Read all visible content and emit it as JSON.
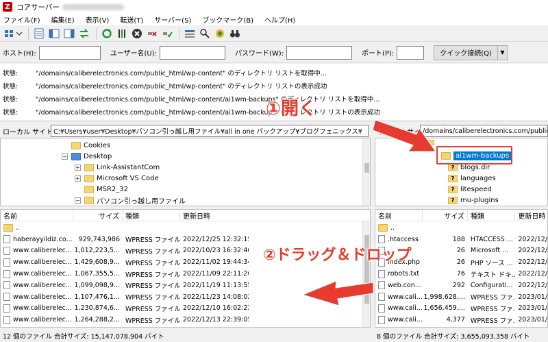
{
  "window": {
    "title": "コアサーバー"
  },
  "menu": [
    "ファイル(F)",
    "編集(E)",
    "表示(V)",
    "転送(T)",
    "サーバー(S)",
    "ブックマーク(B)",
    "ヘルプ(H)"
  ],
  "quickconnect": {
    "host_label": "ホスト(H):",
    "user_label": "ユーザー名(U):",
    "pass_label": "パスワード(W):",
    "port_label": "ポート(P):",
    "button": "クイック接続(Q)"
  },
  "log": [
    {
      "label": "状態:",
      "msg": "\"/domains/caliberelectronics.com/public_html/wp-content\" のディレクトリ リストを取得中..."
    },
    {
      "label": "状態:",
      "msg": "\"/domains/caliberelectronics.com/public_html/wp-content\" のディレクトリ リストの表示成功"
    },
    {
      "label": "状態:",
      "msg": "\"/domains/caliberelectronics.com/public_html/wp-content/ai1wm-backups\" のディレクトリ リストを取得中..."
    },
    {
      "label": "状態:",
      "msg": "\"/domains/caliberelectronics.com/public_html/wp-content/ai1wm-backups\" のディレクトリ リストの表示成功"
    }
  ],
  "annotations": {
    "step1": "①開く",
    "step2": "②ドラッグ＆ドロップ"
  },
  "local": {
    "site_label": "ローカル サイト:",
    "site_path": "C:¥Users¥user¥Desktop¥パソコン引っ越し用ファイル¥all in one バックアップ¥ブログフェニックス¥",
    "tree": [
      {
        "name": "Cookies",
        "type": "folder",
        "depth": 0,
        "expander": ""
      },
      {
        "name": "Desktop",
        "type": "blue",
        "depth": -1,
        "expander": "−"
      },
      {
        "name": "Link-AssistantCom",
        "type": "folder",
        "depth": 1,
        "expander": "+"
      },
      {
        "name": "Microsoft VS Code",
        "type": "folder",
        "depth": 1,
        "expander": "+"
      },
      {
        "name": "MSR2_32",
        "type": "folder",
        "depth": 1,
        "expander": ""
      },
      {
        "name": "パソコン引っ越し用ファイル",
        "type": "folder",
        "depth": 1,
        "expander": "−"
      }
    ],
    "columns": [
      "名前",
      "サイズ",
      "種類",
      "更新日時"
    ],
    "files": [
      {
        "name": "..",
        "size": "",
        "type": "",
        "date": "",
        "folder": true
      },
      {
        "name": "haberayyildiz.co...",
        "size": "929,743,986",
        "type": "WPRESS ファイル",
        "date": "2022/12/25 12:32:15"
      },
      {
        "name": "www.caliberelec...",
        "size": "1,012,223,5...",
        "type": "WPRESS ファイル",
        "date": "2022/10/23 16:32:46"
      },
      {
        "name": "www.caliberelec...",
        "size": "1,429,608,9...",
        "type": "WPRESS ファイル",
        "date": "2022/11/02 19:44:34"
      },
      {
        "name": "www.caliberelec...",
        "size": "1,067,355,5...",
        "type": "WPRESS ファイル",
        "date": "2022/11/09 22:11:26"
      },
      {
        "name": "www.caliberelec...",
        "size": "1,099,098,9...",
        "type": "WPRESS ファイル",
        "date": "2022/11/19 11:13:55"
      },
      {
        "name": "www.caliberelec...",
        "size": "1,107,476,1...",
        "type": "WPRESS ファイル",
        "date": "2022/11/23 14:08:02"
      },
      {
        "name": "www.caliberelec...",
        "size": "1,230,874,6...",
        "type": "WPRESS ファイル",
        "date": "2022/12/10 16:02:22"
      },
      {
        "name": "www.caliberelec...",
        "size": "1,264,288,2...",
        "type": "WPRESS ファイル",
        "date": "2022/12/13 22:39:05"
      }
    ],
    "status": "12 個のファイル 合計サイズ: 15,147,078,904 バイト"
  },
  "remote": {
    "site_label": "リモート サイト:",
    "site_path": "/domains/caliberelectronics.com/public",
    "tree": [
      {
        "name": "ai1wm-backups",
        "type": "folder",
        "selected": true
      },
      {
        "name": "blogs.dir",
        "type": "q"
      },
      {
        "name": "languages",
        "type": "q"
      },
      {
        "name": "litespeed",
        "type": "q"
      },
      {
        "name": "mu-plugins",
        "type": "q"
      }
    ],
    "columns": [
      "名前",
      "サイズ",
      "種類",
      "更新日時"
    ],
    "files": [
      {
        "name": "..",
        "size": "",
        "type": "",
        "date": "",
        "folder": true
      },
      {
        "name": ".htaccess",
        "size": "188",
        "type": "HTACCESS ...",
        "date": "2022/12/"
      },
      {
        "name": "",
        "size": "26",
        "type": "Microsoft ...",
        "date": "2022/12/"
      },
      {
        "name": "index.php",
        "size": "26",
        "type": "PHP ソース ...",
        "date": "2022/12/"
      },
      {
        "name": "robots.txt",
        "size": "76",
        "type": "テキスト ドキ...",
        "date": "2022/12/"
      },
      {
        "name": "web.con...",
        "size": "292",
        "type": "Configurati...",
        "date": "2022/12/"
      },
      {
        "name": "www.cali...",
        "size": "1,998,628,...",
        "type": "WPRESS ファ...",
        "date": "2023/01/"
      },
      {
        "name": "www.cali...",
        "size": "1,656,459,...",
        "type": "WPRESS ファ...",
        "date": "2023/01/"
      },
      {
        "name": "www.cali...",
        "size": "4,377",
        "type": "WPRESS ファ...",
        "date": "2023/01/"
      }
    ],
    "status": "8 個のファイル 合計サイズ: 3,655,093,358 バイト"
  },
  "colors": {
    "annotation": "#e63b2e",
    "selection": "#0078d7"
  }
}
